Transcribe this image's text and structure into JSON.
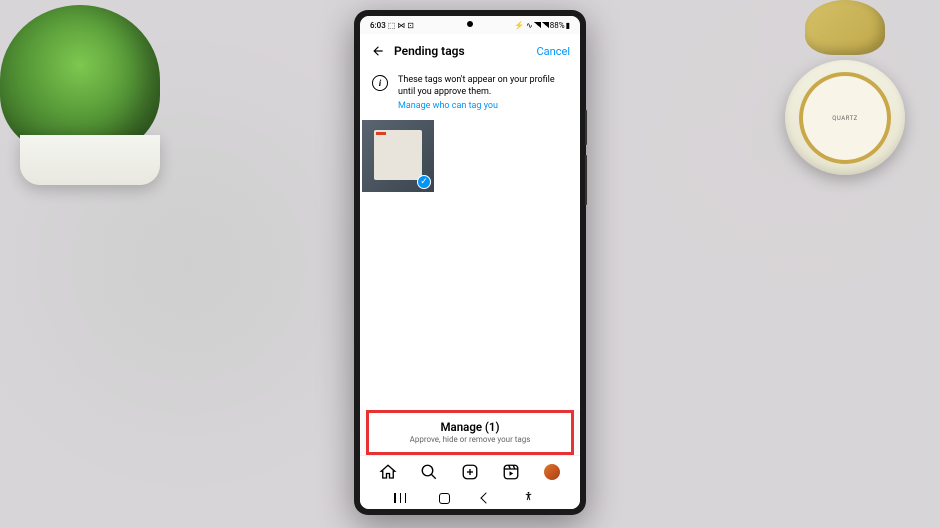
{
  "status_bar": {
    "time": "6:03",
    "icons": "⬚ ⋈ ⊡",
    "right_icons": "⚡ ∿",
    "battery": "88%"
  },
  "header": {
    "title": "Pending tags",
    "cancel": "Cancel"
  },
  "info": {
    "icon": "i",
    "text": "These tags won't appear on your profile until you approve them.",
    "link": "Manage who can tag you"
  },
  "manage": {
    "title": "Manage (1)",
    "subtitle": "Approve, hide or remove your tags"
  },
  "thumb": {
    "check": "✓"
  },
  "clock": {
    "label": "QUARTZ"
  }
}
